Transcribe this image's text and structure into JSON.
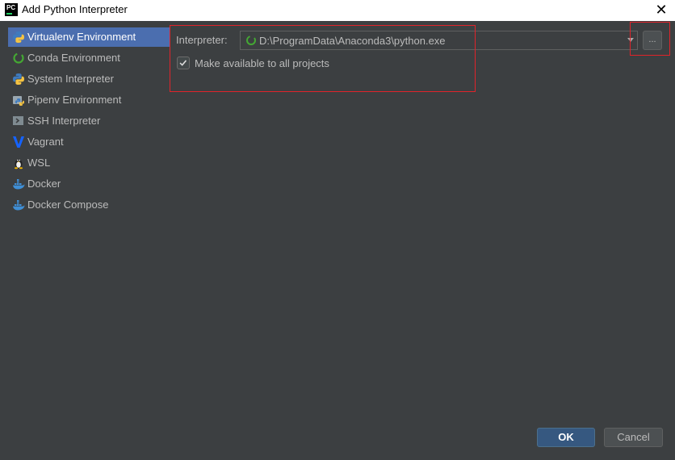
{
  "window": {
    "title": "Add Python Interpreter",
    "app_icon_text": "PC",
    "close_glyph": "✕"
  },
  "sidebar": {
    "items": [
      {
        "label": "Virtualenv Environment",
        "icon": "python-icon",
        "selected": true
      },
      {
        "label": "Conda Environment",
        "icon": "conda-icon",
        "selected": false
      },
      {
        "label": "System Interpreter",
        "icon": "python-icon",
        "selected": false
      },
      {
        "label": "Pipenv Environment",
        "icon": "pipenv-icon",
        "selected": false
      },
      {
        "label": "SSH Interpreter",
        "icon": "ssh-icon",
        "selected": false
      },
      {
        "label": "Vagrant",
        "icon": "vagrant-icon",
        "selected": false
      },
      {
        "label": "WSL",
        "icon": "linux-penguin-icon",
        "selected": false
      },
      {
        "label": "Docker",
        "icon": "docker-icon",
        "selected": false
      },
      {
        "label": "Docker Compose",
        "icon": "docker-icon",
        "selected": false
      }
    ]
  },
  "form": {
    "interpreter_label": "Interpreter:",
    "interpreter_value": "D:\\ProgramData\\Anaconda3\\python.exe",
    "browse_label": "...",
    "make_available_label": "Make available to all projects",
    "make_available_checked": true
  },
  "buttons": {
    "ok": "OK",
    "cancel": "Cancel"
  },
  "colors": {
    "background": "#3c3f41",
    "selection": "#4b6eaf",
    "text": "#bbbbbb",
    "highlight": "#e0232a",
    "ok_button": "#365880"
  }
}
